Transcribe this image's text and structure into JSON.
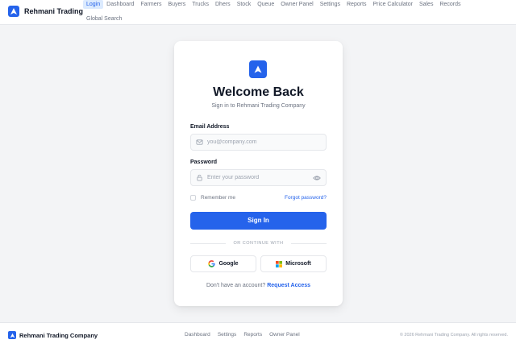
{
  "brand": {
    "name": "Rehmani Trading"
  },
  "nav": {
    "row1": [
      "Login",
      "Dashboard",
      "Farmers",
      "Buyers",
      "Trucks",
      "Dhers",
      "Stock",
      "Queue",
      "Owner Panel",
      "Settings",
      "Reports",
      "Price Calculator",
      "Sales",
      "Records"
    ],
    "row2": [
      "Global Search"
    ],
    "active": "Login"
  },
  "card": {
    "title": "Welcome Back",
    "subtitle": "Sign in to Rehmani Trading Company",
    "email_label": "Email Address",
    "email_placeholder": "you@company.com",
    "email_value": "",
    "password_label": "Password",
    "password_placeholder": "Enter your password",
    "password_value": "",
    "remember_label": "Remember me",
    "forgot_label": "Forgot password?",
    "signin_label": "Sign In",
    "divider_label": "OR CONTINUE WITH",
    "google_label": "Google",
    "microsoft_label": "Microsoft",
    "account_prompt": "Don't have an account?",
    "request_label": "Request Access"
  },
  "footer": {
    "brand": "Rehmani Trading Company",
    "links": [
      "Dashboard",
      "Settings",
      "Reports",
      "Owner Panel"
    ],
    "copyright": "© 2026 Rehmani Trading Company. All rights reserved."
  },
  "icons": {
    "logo": "navigation-arrow-icon",
    "email": "mail-icon",
    "password": "lock-icon",
    "toggle": "eye-icon",
    "google": "google-icon",
    "microsoft": "microsoft-icon"
  },
  "colors": {
    "accent": "#2563eb",
    "active_tab_bg": "#dbeafe",
    "background": "#f3f4f6"
  }
}
